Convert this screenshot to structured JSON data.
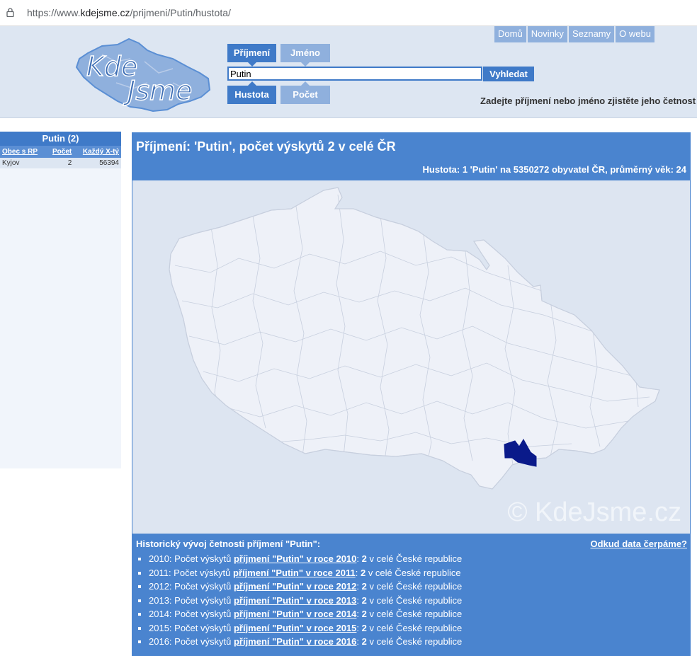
{
  "browser": {
    "url_prefix": "https://www.",
    "url_host": "kdejsme.cz",
    "url_path": "/prijmeni/Putin/hustota/"
  },
  "header": {
    "logo_line1": "Kde",
    "logo_line2": "Jsme",
    "nav": [
      "Domů",
      "Novinky",
      "Seznamy",
      "O webu"
    ],
    "tab_surname": "Příjmení",
    "tab_name": "Jméno",
    "tab_density": "Hustota",
    "tab_count": "Počet",
    "search_value": "Putin",
    "search_button": "Vyhledat",
    "hint": "Zadejte příjmení nebo jméno zjistěte jeho četnost"
  },
  "sidebar": {
    "title": "Putin (2)",
    "columns": [
      "Obec s RP",
      "Počet",
      "Každý X-tý"
    ],
    "rows": [
      {
        "town": "Kyjov",
        "count": "2",
        "every": "56394"
      }
    ]
  },
  "main": {
    "title": "Příjmení: 'Putin', počet výskytů 2 v celé ČR",
    "density": "Hustota: 1 'Putin' na 5350272 obyvatel ČR, průměrný věk: 24",
    "watermark": "© KdeJsme.cz",
    "history_title": "Historický vývoj četnosti příjmení \"Putin\":",
    "source_link": "Odkud data čerpáme?",
    "history": [
      {
        "pre": "2010: Počet výskytů ",
        "link": "příjmení \"Putin\" v roce 2010",
        "colon": ": ",
        "count": "2",
        "post": " v celé České republice"
      },
      {
        "pre": "2011: Počet výskytů ",
        "link": "příjmení \"Putin\" v roce 2011",
        "colon": ": ",
        "count": "2",
        "post": " v celé České republice"
      },
      {
        "pre": "2012: Počet výskytů ",
        "link": "příjmení \"Putin\" v roce 2012",
        "colon": ": ",
        "count": "2",
        "post": " v celé České republice"
      },
      {
        "pre": "2013: Počet výskytů ",
        "link": "příjmení \"Putin\" v roce 2013",
        "colon": ": ",
        "count": "2",
        "post": " v celé České republice"
      },
      {
        "pre": "2014: Počet výskytů ",
        "link": "příjmení \"Putin\" v roce 2014",
        "colon": ": ",
        "count": "2",
        "post": " v celé České republice"
      },
      {
        "pre": "2015: Počet výskytů ",
        "link": "příjmení \"Putin\" v roce 2015",
        "colon": ": ",
        "count": "2",
        "post": " v celé České republice"
      },
      {
        "pre": "2016: Počet výskytů ",
        "link": "příjmení \"Putin\" v roce 2016",
        "colon": ": ",
        "count": "2",
        "post": " v celé České republice"
      }
    ]
  },
  "colors": {
    "accent": "#3f7ac8",
    "panel": "#4a84cf",
    "map_fill": "#eef1f8",
    "highlight": "#0a1a8a"
  }
}
